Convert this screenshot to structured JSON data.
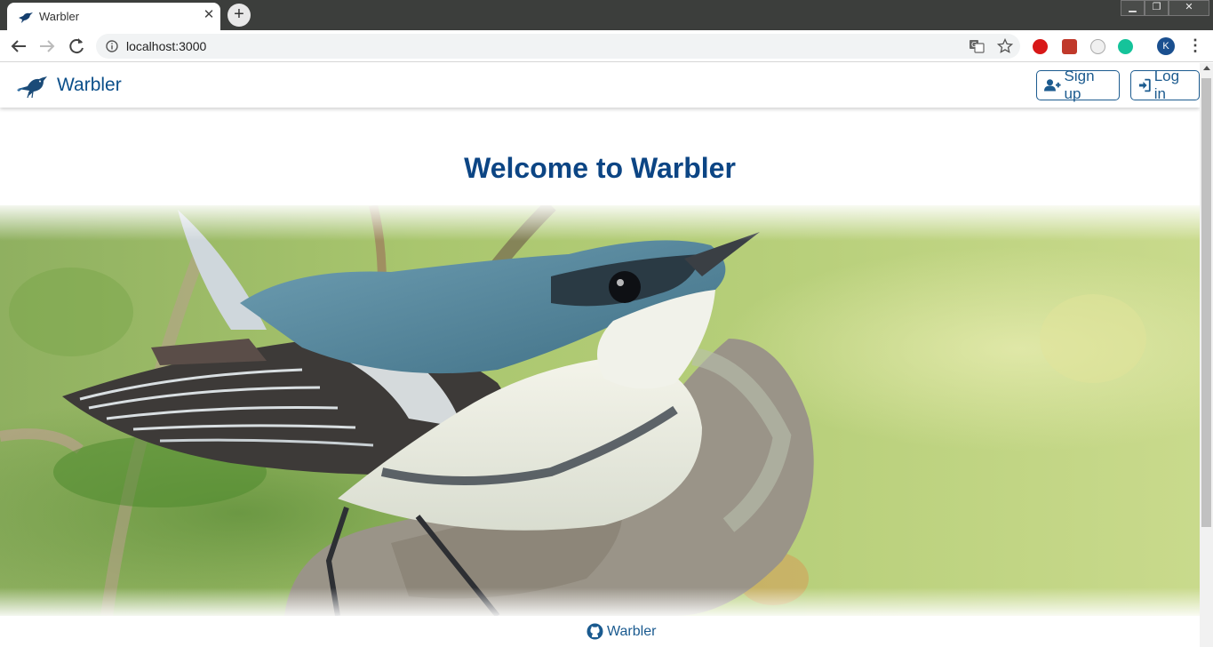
{
  "browser": {
    "tab_title": "Warbler",
    "url": "localhost:3000",
    "profile_initial": "K"
  },
  "site": {
    "brand_name": "Warbler",
    "signup_label": "Sign up",
    "login_label": "Log in",
    "welcome_heading": "Welcome to Warbler",
    "footer_link": "Warbler",
    "accent_color": "#0c4584"
  },
  "icons": {
    "signup": "user-plus-icon",
    "login": "sign-in-icon",
    "footer": "github-icon"
  }
}
